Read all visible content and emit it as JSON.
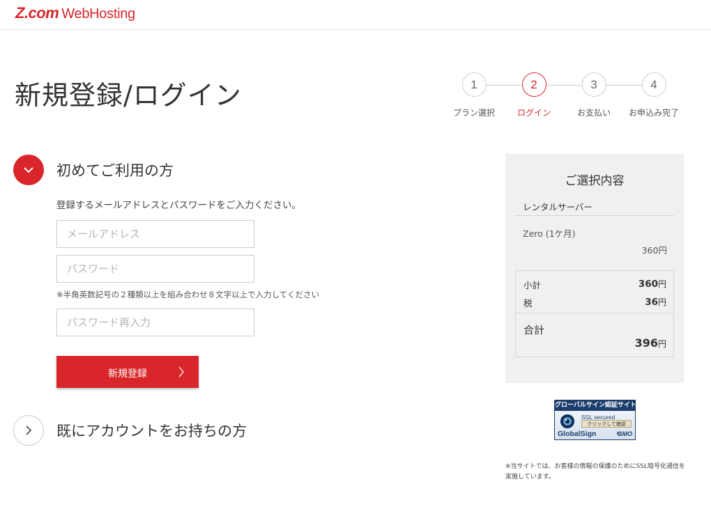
{
  "header": {
    "logo_brand": "Z.com",
    "logo_product": "WebHosting"
  },
  "page_title": "新規登録/ログイン",
  "steps": [
    {
      "number": "1",
      "label": "プラン選択",
      "active": false
    },
    {
      "number": "2",
      "label": "ログイン",
      "active": true
    },
    {
      "number": "3",
      "label": "お支払い",
      "active": false
    },
    {
      "number": "4",
      "label": "お申込み完了",
      "active": false
    }
  ],
  "new_user": {
    "title": "初めてご利用の方",
    "instruction": "登録するメールアドレスとパスワードをご入力ください。",
    "email_placeholder": "メールアドレス",
    "password_placeholder": "パスワード",
    "password_note": "※半角英数記号の２種類以上を組み合わせ８文字以上で入力してください",
    "password_confirm_placeholder": "パスワード再入力",
    "submit_label": "新規登録"
  },
  "existing_user": {
    "title": "既にアカウントをお持ちの方"
  },
  "summary": {
    "title": "ご選択内容",
    "category": "レンタルサーバー",
    "plan_name": "Zero (1ケ月)",
    "plan_price": "360円",
    "subtotal_label": "小計",
    "subtotal_value": "360",
    "tax_label": "税",
    "tax_value": "36",
    "total_label": "合計",
    "total_value": "396",
    "currency": "円"
  },
  "seal": {
    "top_text": "グローバルサイン認証サイト",
    "ssl_text": "SSL secured",
    "click_text": "クリックして確認",
    "brand": "GlobalSign",
    "by": "by",
    "gmo": "GMO"
  },
  "ssl_note": "※当サイトでは、お客様の情報の保護のためにSSL暗号化通信を実施しています。",
  "colors": {
    "accent": "#d8262a",
    "panel": "#f0f0f0",
    "border": "#cccccc"
  }
}
